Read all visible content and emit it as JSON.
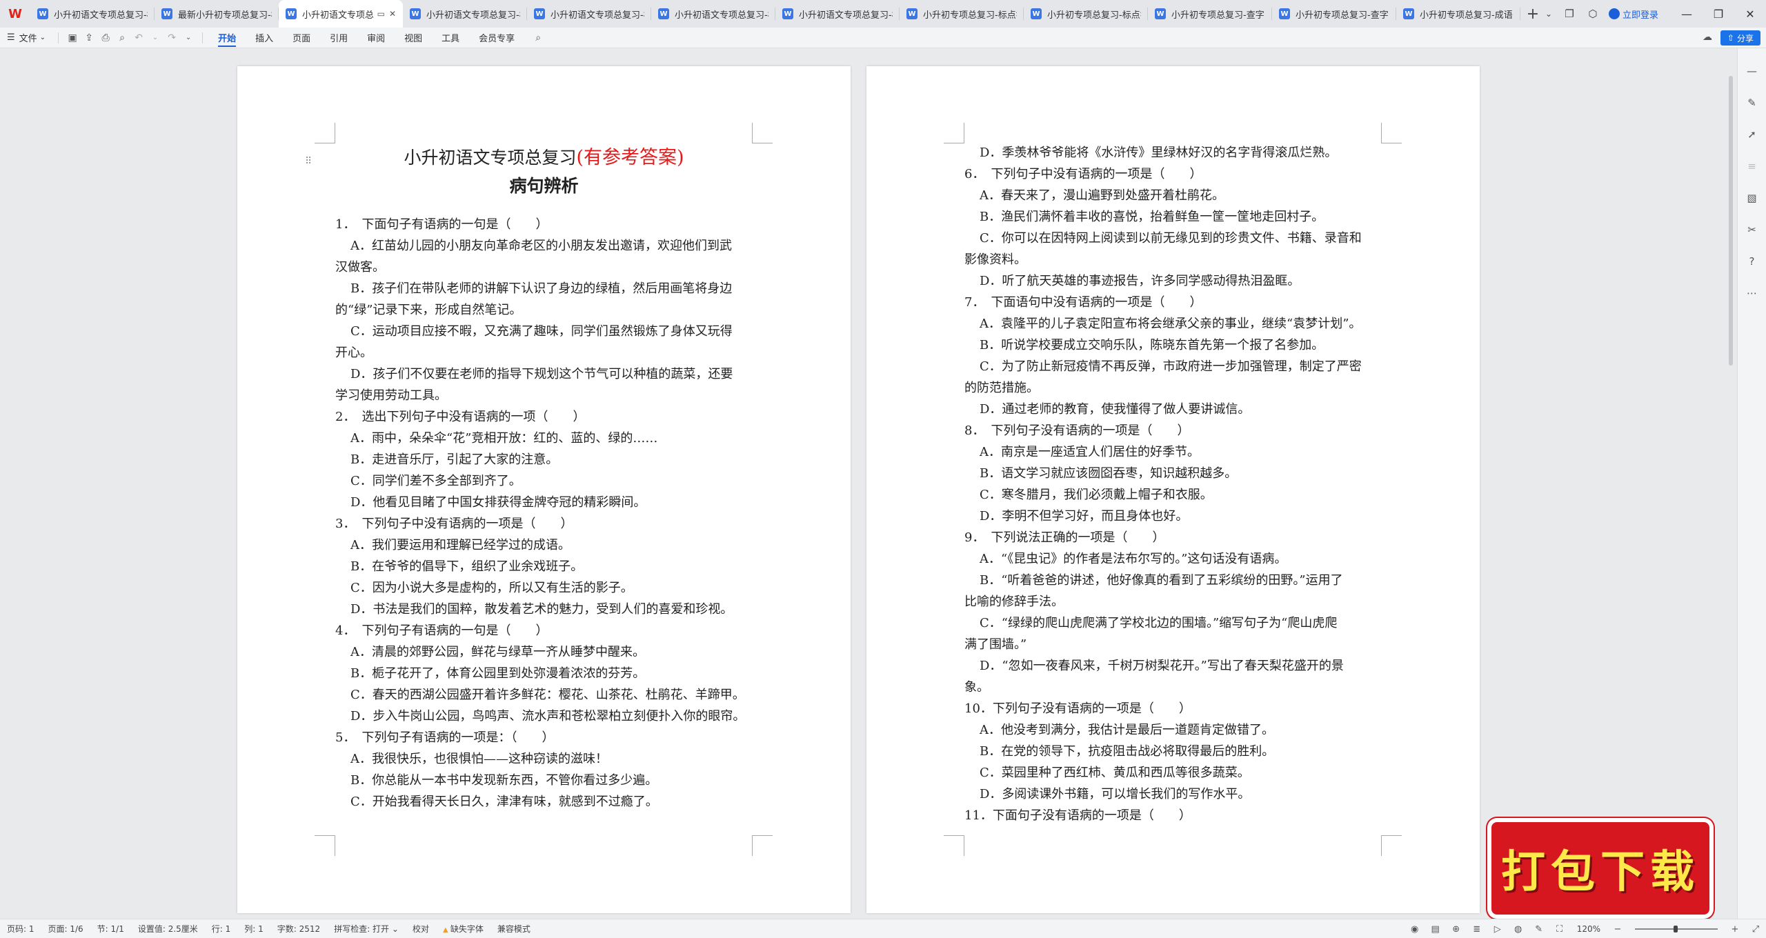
{
  "tabbar": {
    "tabs": [
      {
        "label": "小升初语文专项总复习-标"
      },
      {
        "label": "最新小升初专项总复习-标"
      },
      {
        "label": "小升初语文专项总",
        "active": true
      },
      {
        "label": "小升初语文专项总复习-标"
      },
      {
        "label": "小升初语文专项总复习-标"
      },
      {
        "label": "小升初语文专项总复习-标"
      },
      {
        "label": "小升初语文专项总复习-标"
      },
      {
        "label": "小升初专项总复习-标点符"
      },
      {
        "label": "小升初专项总复习-标点符"
      },
      {
        "label": "小升初专项总复习-查字"
      },
      {
        "label": "小升初专项总复习-查字"
      },
      {
        "label": "小升初专项总复习-成语"
      }
    ],
    "login_label": "立即登录"
  },
  "ribbon": {
    "file_label": "文件",
    "menu_tabs": [
      "开始",
      "插入",
      "页面",
      "引用",
      "审阅",
      "视图",
      "工具",
      "会员专享"
    ],
    "share_label": "分享"
  },
  "page1": {
    "title_main": "小升初语文专项总复习",
    "title_red": "(有参考答案)",
    "subtitle": "病句辨析",
    "lines": [
      {
        "cls": "q",
        "text": "1．　下面句子有语病的一句是（　　）"
      },
      {
        "cls": "opt",
        "text": "A．红苗幼儿园的小朋友向革命老区的小朋友发出邀请，欢迎他们到武"
      },
      {
        "cls": "cont",
        "text": "汉做客。"
      },
      {
        "cls": "opt",
        "text": "B．孩子们在带队老师的讲解下认识了身边的绿植，然后用画笔将身边"
      },
      {
        "cls": "cont",
        "text": "的“绿”记录下来，形成自然笔记。"
      },
      {
        "cls": "opt",
        "text": "C．运动项目应接不暇，又充满了趣味，同学们虽然锻炼了身体又玩得"
      },
      {
        "cls": "cont",
        "text": "开心。"
      },
      {
        "cls": "opt",
        "text": "D．孩子们不仅要在老师的指导下规划这个节气可以种植的蔬菜，还要"
      },
      {
        "cls": "cont",
        "text": "学习使用劳动工具。"
      },
      {
        "cls": "q",
        "text": "2．　选出下列句子中没有语病的一项（　　）"
      },
      {
        "cls": "opt",
        "text": "A．雨中，朵朵伞“花”竞相开放：红的、蓝的、绿的……"
      },
      {
        "cls": "opt",
        "text": "B．走进音乐厅，引起了大家的注意。"
      },
      {
        "cls": "opt",
        "text": "C．同学们差不多全部到齐了。"
      },
      {
        "cls": "opt",
        "text": "D．他看见目睹了中国女排获得金牌夺冠的精彩瞬间。"
      },
      {
        "cls": "q",
        "text": "3．　下列句子中没有语病的一项是（　　）"
      },
      {
        "cls": "opt",
        "text": "A．我们要运用和理解已经学过的成语。"
      },
      {
        "cls": "opt",
        "text": "B．在爷爷的倡导下，组织了业余戏班子。"
      },
      {
        "cls": "opt",
        "text": "C．因为小说大多是虚构的，所以又有生活的影子。"
      },
      {
        "cls": "opt",
        "text": "D．书法是我们的国粹，散发着艺术的魅力，受到人们的喜爱和珍视。"
      },
      {
        "cls": "q",
        "text": "4．　下列句子有语病的一句是（　　）"
      },
      {
        "cls": "opt",
        "text": "A．清晨的郊野公园，鲜花与绿草一齐从睡梦中醒来。"
      },
      {
        "cls": "opt",
        "text": "B．栀子花开了，体育公园里到处弥漫着浓浓的芬芳。"
      },
      {
        "cls": "opt",
        "text": "C．春天的西湖公园盛开着许多鲜花：樱花、山茶花、杜鹃花、羊蹄甲。"
      },
      {
        "cls": "opt",
        "text": "D．步入牛岗山公园，鸟鸣声、流水声和苍松翠柏立刻便扑入你的眼帘。"
      },
      {
        "cls": "q",
        "text": "5．　下列句子有语病的一项是：（　　）"
      },
      {
        "cls": "opt",
        "text": "A．我很快乐，也很惧怕——这种窃读的滋味！"
      },
      {
        "cls": "opt",
        "text": "B．你总能从一本书中发现新东西，不管你看过多少遍。"
      },
      {
        "cls": "opt",
        "text": "C．开始我看得天长日久，津津有味，就感到不过瘾了。"
      }
    ]
  },
  "page2": {
    "lines": [
      {
        "cls": "opt",
        "text": "D．季羡林爷爷能将《水浒传》里绿林好汉的名字背得滚瓜烂熟。"
      },
      {
        "cls": "q",
        "text": "6．　下列句子中没有语病的一项是（　　）"
      },
      {
        "cls": "opt",
        "text": "A．春天来了，漫山遍野到处盛开着杜鹃花。"
      },
      {
        "cls": "opt",
        "text": "B．渔民们满怀着丰收的喜悦，抬着鲜鱼一筐一筐地走回村子。"
      },
      {
        "cls": "opt",
        "text": "C．你可以在因特网上阅读到以前无缘见到的珍贵文件、书籍、录音和"
      },
      {
        "cls": "cont",
        "text": "影像资料。"
      },
      {
        "cls": "opt",
        "text": "D．听了航天英雄的事迹报告，许多同学感动得热泪盈眶。"
      },
      {
        "cls": "q",
        "text": "7．　下面语句中没有语病的一项是（　　）"
      },
      {
        "cls": "opt",
        "text": "A．袁隆平的儿子袁定阳宣布将会继承父亲的事业，继续“袁梦计划”。"
      },
      {
        "cls": "opt",
        "text": "B．听说学校要成立交响乐队，陈晓东首先第一个报了名参加。"
      },
      {
        "cls": "opt",
        "text": "C．为了防止新冠疫情不再反弹，市政府进一步加强管理，制定了严密"
      },
      {
        "cls": "cont",
        "text": "的防范措施。"
      },
      {
        "cls": "opt",
        "text": "D．通过老师的教育，使我懂得了做人要讲诚信。"
      },
      {
        "cls": "q",
        "text": "8．　下列句子没有语病的一项是（　　）"
      },
      {
        "cls": "opt",
        "text": "A．南京是一座适宜人们居住的好季节。"
      },
      {
        "cls": "opt",
        "text": "B．语文学习就应该囫囵吞枣，知识越积越多。"
      },
      {
        "cls": "opt",
        "text": "C．寒冬腊月，我们必须戴上帽子和衣服。"
      },
      {
        "cls": "opt",
        "text": "D．李明不但学习好，而且身体也好。"
      },
      {
        "cls": "q",
        "text": "9．　下列说法正确的一项是（　　）"
      },
      {
        "cls": "opt",
        "text": "A．“《昆虫记》的作者是法布尔写的。”这句话没有语病。"
      },
      {
        "cls": "opt",
        "text": "B．“听着爸爸的讲述，他好像真的看到了五彩缤纷的田野。”运用了"
      },
      {
        "cls": "cont",
        "text": "比喻的修辞手法。"
      },
      {
        "cls": "opt",
        "text": "C．“绿绿的爬山虎爬满了学校北边的围墙。”缩写句子为“爬山虎爬"
      },
      {
        "cls": "cont",
        "text": "满了围墙。”"
      },
      {
        "cls": "opt",
        "text": "D．“忽如一夜春风来，千树万树梨花开。”写出了春天梨花盛开的景"
      },
      {
        "cls": "cont",
        "text": "象。"
      },
      {
        "cls": "q",
        "text": "10．下列句子没有语病的一项是（　　）"
      },
      {
        "cls": "opt",
        "text": "A．他没考到满分，我估计是最后一道题肯定做错了。"
      },
      {
        "cls": "opt",
        "text": "B．在党的领导下，抗疫阻击战必将取得最后的胜利。"
      },
      {
        "cls": "opt",
        "text": "C．菜园里种了西红柿、黄瓜和西瓜等很多蔬菜。"
      },
      {
        "cls": "opt",
        "text": "D．多阅读课外书籍，可以增长我们的写作水平。"
      },
      {
        "cls": "q",
        "text": "11．下面句子没有语病的一项是（　　）"
      }
    ]
  },
  "badge": {
    "label": "打包下载"
  },
  "statusbar": {
    "items": [
      "页码: 1",
      "页面: 1/6",
      "节: 1/1",
      "设置值: 2.5厘米",
      "行: 1",
      "列: 1",
      "字数: 2512",
      "拼写检查: 打开 ⌄",
      "校对"
    ],
    "warn": "缺失字体",
    "compat": "兼容模式",
    "zoom": "120%"
  },
  "colors": {
    "accent": "#1a5fd9",
    "title_red": "#e81818",
    "badge_red": "#d7171f",
    "badge_text": "#ffe84a"
  }
}
